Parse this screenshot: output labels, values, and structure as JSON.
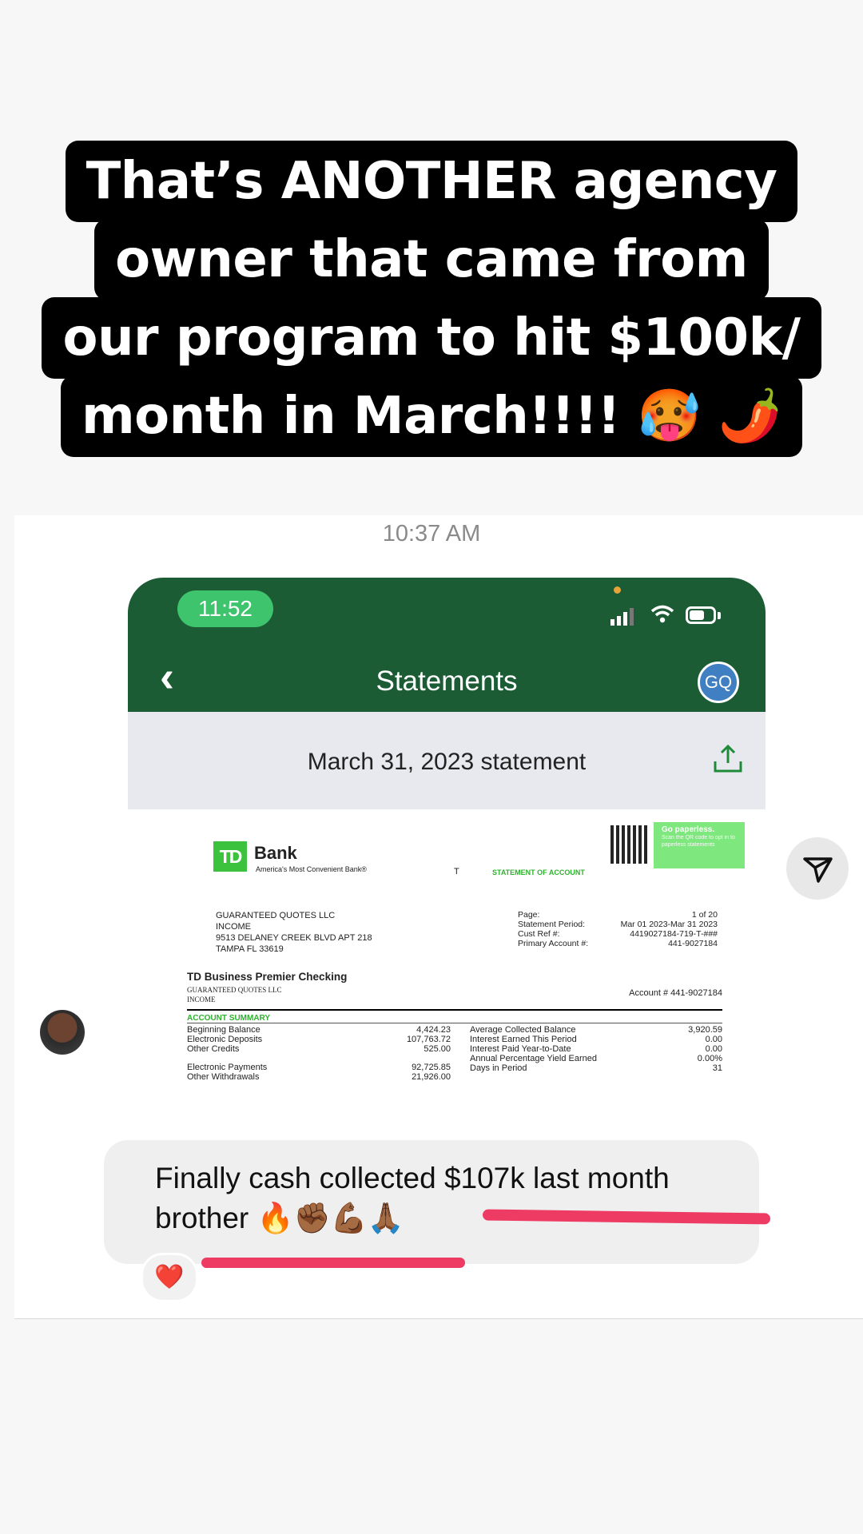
{
  "caption": {
    "line1": "That’s ANOTHER agency",
    "line2": "owner that came from",
    "line3": "our program to hit $100k/",
    "line4": "month in March!!!! 🥵 🌶️"
  },
  "timestamp": "10:37 AM",
  "phone": {
    "time": "11:52",
    "header_title": "Statements",
    "avatar_initials": "GQ",
    "statement_title": "March 31, 2023 statement",
    "icons": {
      "back": "back-chevron-icon",
      "share": "share-upload-icon",
      "wifi": "wifi-icon",
      "signal": "signal-icon",
      "battery": "battery-icon"
    }
  },
  "statement_doc": {
    "logo": "TD",
    "bank_name": "Bank",
    "tagline": "America's Most Convenient Bank®",
    "t_mark": "T",
    "label": "STATEMENT OF ACCOUNT",
    "paperless_title": "Go paperless.",
    "paperless_text": "Scan the QR code to opt in to paperless statements",
    "address": [
      "GUARANTEED QUOTES LLC",
      "INCOME",
      "9513 DELANEY CREEK BLVD APT 218",
      "TAMPA FL 33619"
    ],
    "meta": [
      {
        "label": "Page:",
        "value": "1 of 20"
      },
      {
        "label": "Statement Period:",
        "value": "Mar 01 2023-Mar 31 2023"
      },
      {
        "label": "Cust Ref #:",
        "value": "4419027184-719-T-###"
      },
      {
        "label": "Primary Account #:",
        "value": "441-9027184"
      }
    ],
    "product_name": "TD Business Premier Checking",
    "product_sub1": "GUARANTEED QUOTES LLC",
    "product_sub2": "INCOME",
    "account_number": "Account # 441-9027184",
    "summary_label": "ACCOUNT SUMMARY",
    "summary_left": [
      {
        "label": "Beginning Balance",
        "value": "4,424.23"
      },
      {
        "label": "Electronic Deposits",
        "value": "107,763.72"
      },
      {
        "label": "Other Credits",
        "value": "525.00"
      },
      {
        "label": "Electronic Payments",
        "value": "92,725.85"
      },
      {
        "label": "Other Withdrawals",
        "value": "21,926.00"
      }
    ],
    "summary_right": [
      {
        "label": "Average Collected Balance",
        "value": "3,920.59"
      },
      {
        "label": "Interest Earned This Period",
        "value": "0.00"
      },
      {
        "label": "Interest Paid Year-to-Date",
        "value": "0.00"
      },
      {
        "label": "Annual Percentage Yield Earned",
        "value": "0.00%"
      },
      {
        "label": "Days in Period",
        "value": "31"
      }
    ]
  },
  "message": {
    "text_part1": "Finally cash collected $107k last month",
    "text_part2": "brother ",
    "emojis": "🔥✊🏾💪🏾🙏🏾",
    "reaction": "❤️",
    "underline_color": "#ee3b63"
  },
  "icons": {
    "send": "send-paper-plane-icon",
    "sender_avatar": "sender-avatar"
  }
}
